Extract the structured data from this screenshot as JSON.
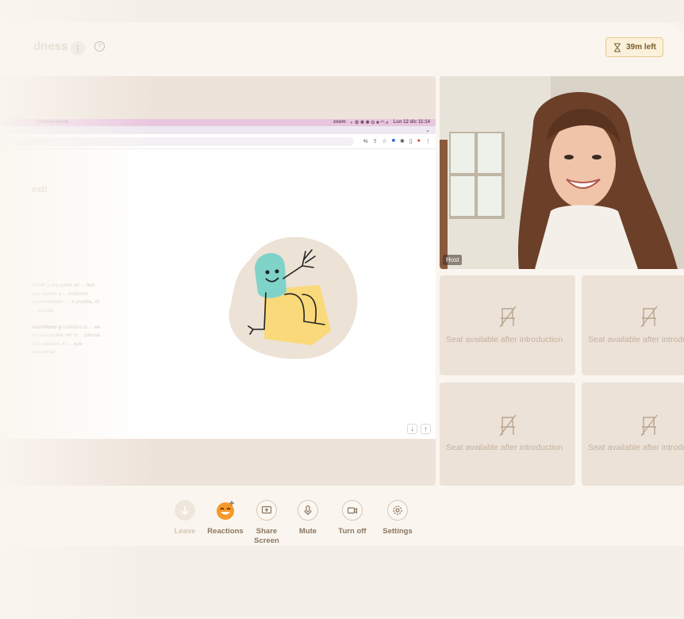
{
  "header": {
    "title_fragment": "dness",
    "info_label": "⋮",
    "help_label": "?",
    "timer": "39m left"
  },
  "shared_screen": {
    "menubar_left": "Ventana  Ayuda",
    "menubar_right": [
      "zoom",
      "Lun 12 dic 11:14"
    ],
    "headline_fragment": "est!",
    "paragraph_1": "Sarah y soy parte de ... test que vamos a ... estamos desarrollando. ... a prueba. Al ... esesta.",
    "paragraph_2_bold": "micrófono y",
    "paragraph_2": "habilites tu ... ee es para poder ver lo ... piensa o te atascas, lo ... que solucionar",
    "scroll_down": "↓",
    "scroll_up": "↑"
  },
  "host": {
    "label": "Host"
  },
  "seats": [
    {
      "label": "Seat available after introduction"
    },
    {
      "label": "Seat available after introduction"
    },
    {
      "label": "Seat available after introduction"
    },
    {
      "label": "Seat available after introduction"
    }
  ],
  "controls": [
    {
      "label": "Leave",
      "icon": "arrow-down-icon"
    },
    {
      "label": "Reactions",
      "icon": "emoji-icon"
    },
    {
      "label": "Share Screen",
      "icon": "share-screen-icon"
    },
    {
      "label": "Mute",
      "icon": "microphone-icon"
    },
    {
      "label": "Turn off",
      "icon": "camera-icon"
    },
    {
      "label": "Settings",
      "icon": "gear-icon"
    }
  ],
  "colors": {
    "background": "#faf6ef",
    "timer_border": "#e7c98f",
    "seat_fill": "#ece2d8",
    "accent_label": "#8a7660"
  }
}
